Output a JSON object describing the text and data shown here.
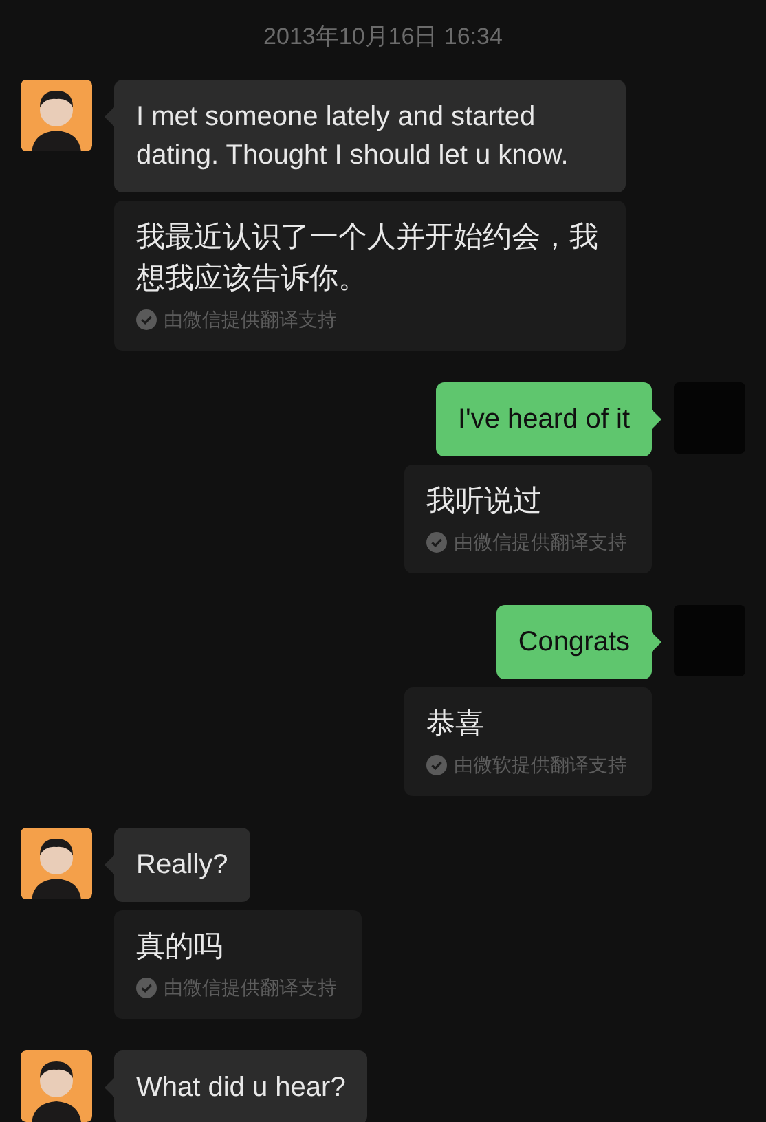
{
  "timestamp": "2013年10月16日 16:34",
  "messages": [
    {
      "kind": "in",
      "text": "I met someone lately and started dating.  Thought I should let u know.",
      "translation": {
        "text": "我最近认识了一个人并开始约会，我想我应该告诉你。",
        "note": "由微信提供翻译支持"
      }
    },
    {
      "kind": "out",
      "text": "I've heard of it",
      "translation": {
        "text": "我听说过",
        "note": "由微信提供翻译支持"
      }
    },
    {
      "kind": "out",
      "text": "Congrats",
      "translation": {
        "text": "恭喜",
        "note": "由微软提供翻译支持"
      }
    },
    {
      "kind": "in",
      "text": "Really?",
      "translation": {
        "text": "真的吗",
        "note": "由微信提供翻译支持"
      }
    },
    {
      "kind": "in",
      "text": "What did u hear?"
    }
  ]
}
